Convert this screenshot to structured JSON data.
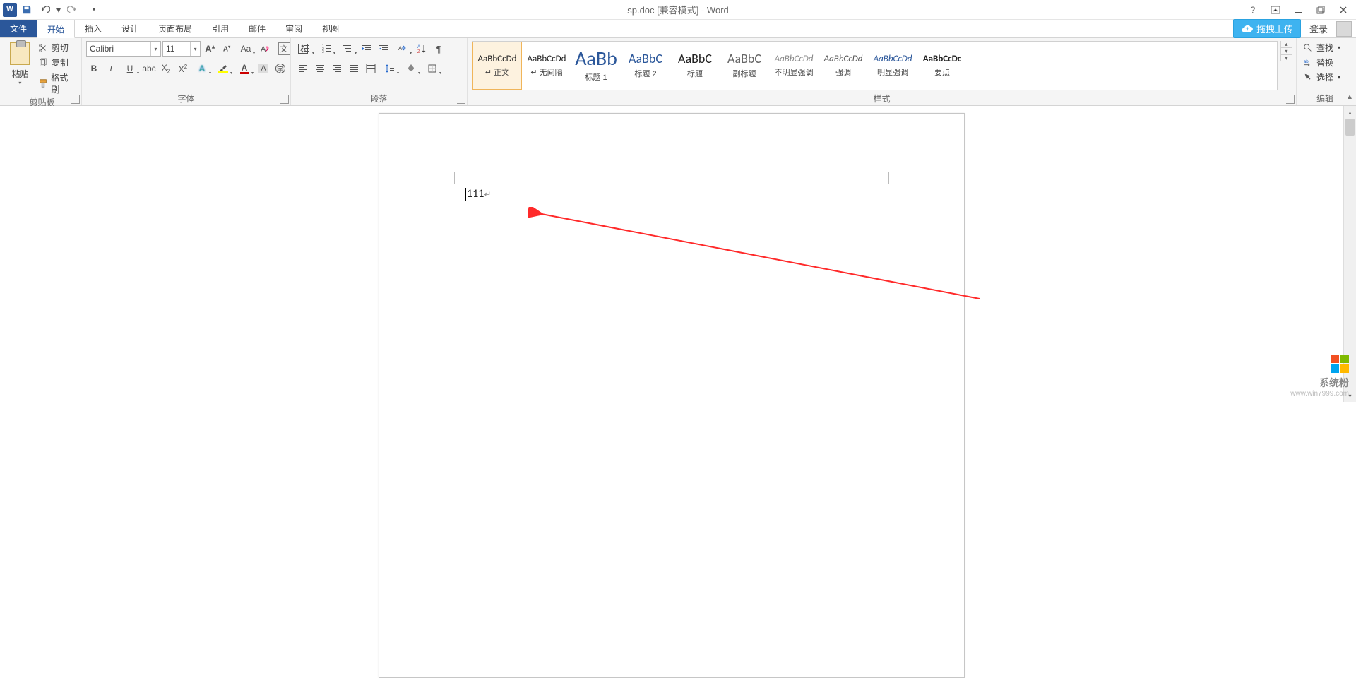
{
  "title": "sp.doc [兼容模式] - Word",
  "qat": {
    "save": "保存",
    "undo": "撤销",
    "redo": "恢复"
  },
  "upload": "拖拽上传",
  "login": "登录",
  "tabs": {
    "file": "文件",
    "home": "开始",
    "insert": "插入",
    "design": "设计",
    "layout": "页面布局",
    "references": "引用",
    "mail": "邮件",
    "review": "审阅",
    "view": "视图"
  },
  "clipboard": {
    "paste": "粘贴",
    "cut": "剪切",
    "copy": "复制",
    "format_painter": "格式刷",
    "group": "剪贴板"
  },
  "font": {
    "name": "Calibri",
    "size": "11",
    "group": "字体",
    "casebox": "文"
  },
  "paragraph": {
    "group": "段落"
  },
  "styles": {
    "group": "样式",
    "items": [
      {
        "preview": "AaBbCcDd",
        "name": "↵ 正文",
        "cls": "p-normal",
        "selected": true
      },
      {
        "preview": "AaBbCcDd",
        "name": "↵ 无间隔",
        "cls": "p-nospace",
        "selected": false
      },
      {
        "preview": "AaBb",
        "name": "标题 1",
        "cls": "p-h1",
        "selected": false
      },
      {
        "preview": "AaBbC",
        "name": "标题 2",
        "cls": "p-h2",
        "selected": false
      },
      {
        "preview": "AaBbC",
        "name": "标题",
        "cls": "p-title",
        "selected": false
      },
      {
        "preview": "AaBbC",
        "name": "副标题",
        "cls": "p-sub",
        "selected": false
      },
      {
        "preview": "AaBbCcDd",
        "name": "不明显强调",
        "cls": "p-subtle",
        "selected": false
      },
      {
        "preview": "AaBbCcDd",
        "name": "强调",
        "cls": "p-emph",
        "selected": false
      },
      {
        "preview": "AaBbCcDd",
        "name": "明显强调",
        "cls": "p-strong",
        "selected": false
      },
      {
        "preview": "AaBbCcDc",
        "name": "要点",
        "cls": "p-point",
        "selected": false
      }
    ]
  },
  "style_preview_css": {
    "p-normal": "font-size:13px;",
    "p-nospace": "font-size:13px;",
    "p-h1": "font-size:28px;color:#2b579a;",
    "p-h2": "font-size:18px;color:#2b579a;",
    "p-title": "font-size:18px;",
    "p-sub": "font-size:18px;color:#666;",
    "p-subtle": "font-size:13px;font-style:italic;color:#888;",
    "p-emph": "font-size:13px;font-style:italic;color:#555;",
    "p-strong": "font-size:13px;font-style:italic;color:#2b579a;",
    "p-point": "font-size:13px;font-weight:bold;"
  },
  "editing": {
    "find": "查找",
    "replace": "替换",
    "select": "选择",
    "group": "编辑"
  },
  "document": {
    "text": "111",
    "para_mark": "↵"
  },
  "watermark": {
    "brand": "系统粉",
    "url": "www.win7999.com",
    "colors": [
      "#f25022",
      "#7fba00",
      "#00a4ef",
      "#ffb900"
    ]
  }
}
